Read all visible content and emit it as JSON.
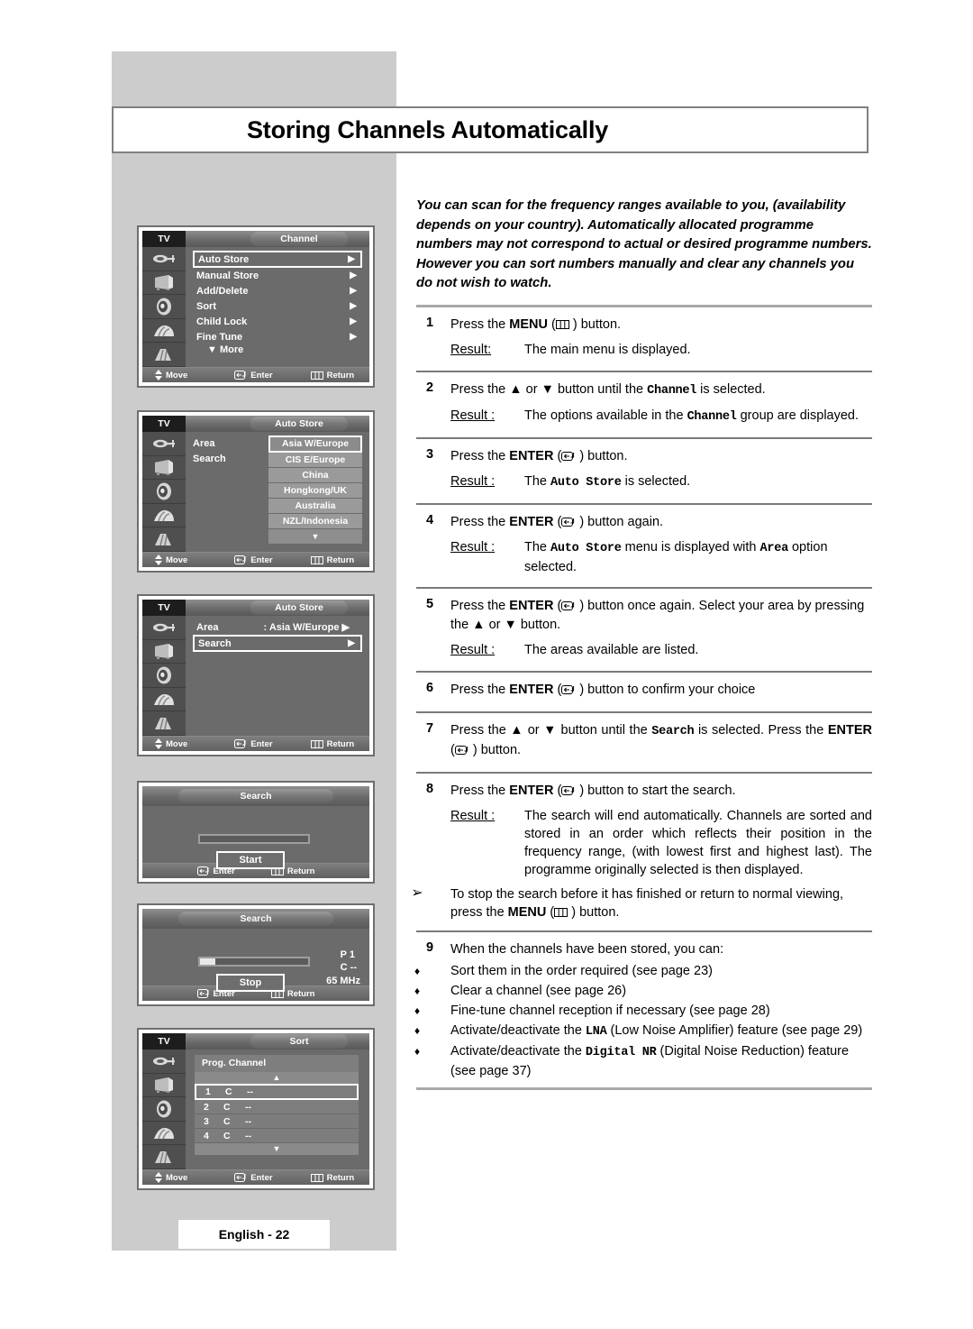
{
  "page": {
    "title": "Storing Channels Automatically",
    "footer_label": "English - 22"
  },
  "intro": "You can scan for the frequency ranges available to you, (availability depends on your country). Automatically allocated programme numbers may not correspond to actual or desired programme numbers. However you can sort numbers manually and clear any channels you do not wish to watch.",
  "labels": {
    "result": "Result:",
    "result_sp": "Result :"
  },
  "steps": [
    {
      "num": "1",
      "instruction_pre": "Press the ",
      "instruction_bold": "MENU",
      "instruction_icon": "menu-icon",
      "instruction_post": " ) button.",
      "result_label": "Result:",
      "result": "The main menu is displayed."
    },
    {
      "num": "2",
      "instruction_pre": "Press the ▲ or ▼ button until the ",
      "instruction_mono": "Channel",
      "instruction_post": " is selected.",
      "result_label": "Result :",
      "result_pre": "The options available in the ",
      "result_mono": "Channel",
      "result_post": " group are displayed."
    },
    {
      "num": "3",
      "instruction_pre": "Press the ",
      "instruction_bold": "ENTER",
      "instruction_icon": "enter-icon",
      "instruction_post": " ) button.",
      "result_label": "Result :",
      "result_pre": "The ",
      "result_mono": "Auto Store",
      "result_post": " is selected."
    },
    {
      "num": "4",
      "instruction_pre": "Press the ",
      "instruction_bold": "ENTER",
      "instruction_icon": "enter-icon",
      "instruction_post": " ) button again.",
      "result_label": "Result :",
      "result_pre": "The ",
      "result_mono": "Auto Store",
      "result_mid": " menu is displayed with ",
      "result_mono2": "Area",
      "result_post": " option selected."
    },
    {
      "num": "5",
      "instruction_pre": "Press the ",
      "instruction_bold": "ENTER",
      "instruction_icon": "enter-icon",
      "instruction_post": " ) button once again. Select your area by pressing the ▲ or ▼ button.",
      "result_label": "Result :",
      "result": "The areas available are listed."
    },
    {
      "num": "6",
      "instruction_pre": "Press the ",
      "instruction_bold": "ENTER",
      "instruction_icon": "enter-icon",
      "instruction_post": " ) button to confirm your choice"
    },
    {
      "num": "7",
      "instruction_pre": "Press the ▲ or ▼ button until the ",
      "instruction_mono": "Search",
      "instruction_post": " is selected. Press the ",
      "instruction_bold2": "ENTER",
      "instruction_post2": " ) button."
    },
    {
      "num": "8",
      "instruction_pre": "Press the ",
      "instruction_bold": "ENTER",
      "instruction_icon": "enter-icon",
      "instruction_post": " ) button to start the search.",
      "result_label": "Result :",
      "result": "The search will end automatically. Channels are sorted and stored in an order which reflects their position in the frequency range, (with lowest first and highest last). The programme originally selected is then displayed.",
      "note_mark": "➢",
      "note_pre": "To stop the search before it has finished or return to normal viewing, press the  ",
      "note_bold": "MENU",
      "note_post": " ) button."
    },
    {
      "num": "9",
      "instruction_pre": "When the channels have been stored, you can:"
    }
  ],
  "bullets": [
    {
      "mark": "♦",
      "text": "Sort them in the order required (see page 23)"
    },
    {
      "mark": "♦",
      "text": "Clear a channel (see page 26)"
    },
    {
      "mark": "♦",
      "text": "Fine-tune channel reception if necessary (see page 28)"
    },
    {
      "mark": "♦",
      "pre": "Activate/deactivate the ",
      "mono": "LNA",
      "post": " (Low Noise Amplifier) feature (see page 29)"
    },
    {
      "mark": "♦",
      "pre": "Activate/deactivate the ",
      "mono": "Digital NR",
      "post": " (Digital Noise Reduction) feature (see page 37)"
    }
  ],
  "osd_footer": {
    "move": "Move",
    "enter": "Enter",
    "return": "Return"
  },
  "panel_channel": {
    "tv": "TV",
    "tab": "Channel",
    "rows": [
      {
        "label": "Auto Store",
        "arrow": "▶",
        "selected": true
      },
      {
        "label": "Manual Store",
        "arrow": "▶",
        "selected": false
      },
      {
        "label": "Add/Delete",
        "arrow": "▶",
        "selected": false
      },
      {
        "label": "Sort",
        "arrow": "▶",
        "selected": false
      },
      {
        "label": "Child Lock",
        "arrow": "▶",
        "selected": false
      },
      {
        "label": "Fine Tune",
        "arrow": "▶",
        "selected": false
      }
    ],
    "more": "▼ More"
  },
  "panel_autostore_list": {
    "tv": "TV",
    "tab": "Auto Store",
    "area_label": "Area",
    "colon": ":",
    "search_label": "Search",
    "options": [
      {
        "label": "Asia W/Europe",
        "selected": true
      },
      {
        "label": "CIS E/Europe",
        "selected": false
      },
      {
        "label": "China",
        "selected": false
      },
      {
        "label": "Hongkong/UK",
        "selected": false
      },
      {
        "label": "Australia",
        "selected": false
      },
      {
        "label": "NZL/Indonesia",
        "selected": false
      }
    ],
    "more_arrow": "▼"
  },
  "panel_autostore_search": {
    "tv": "TV",
    "tab": "Auto Store",
    "area_label": "Area",
    "area_value": ": Asia W/Europe ▶",
    "search_label": "Search",
    "search_arrow": "▶"
  },
  "panel_search_start": {
    "tab": "Search",
    "button": "Start",
    "progress_percent": 0,
    "enter": "Enter",
    "return": "Return"
  },
  "panel_search_stop": {
    "tab": "Search",
    "button": "Stop",
    "progress_percent": 14,
    "prog_line1": "P  1",
    "prog_line2": "C --",
    "frequency": "65 MHz",
    "enter": "Enter",
    "return": "Return"
  },
  "panel_sort": {
    "tv": "TV",
    "tab": "Sort",
    "header": "Prog. Channel",
    "up_arrow": "▲",
    "down_arrow": "▼",
    "rows": [
      {
        "n": "1",
        "c": "C",
        "v": "--",
        "selected": true
      },
      {
        "n": "2",
        "c": "C",
        "v": "--",
        "selected": false
      },
      {
        "n": "3",
        "c": "C",
        "v": "--",
        "selected": false
      },
      {
        "n": "4",
        "c": "C",
        "v": "--",
        "selected": false
      }
    ]
  },
  "colors": {
    "band": "#cccccc",
    "osd_bg": "#6b6b6b",
    "rule": "#a8a8a8"
  }
}
